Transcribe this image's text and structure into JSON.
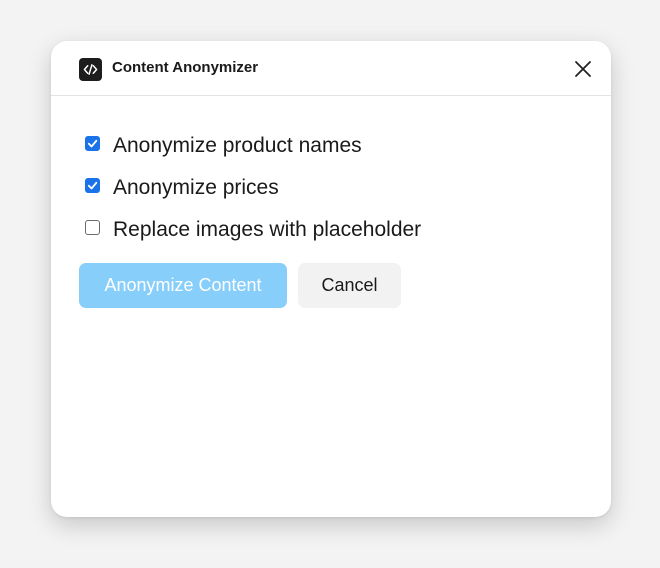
{
  "dialog": {
    "title": "Content Anonymizer",
    "app_icon": "code-icon",
    "close_icon": "close-icon"
  },
  "options": [
    {
      "label": "Anonymize product names",
      "checked": true
    },
    {
      "label": "Anonymize prices",
      "checked": true
    },
    {
      "label": "Replace images with placeholder",
      "checked": false
    }
  ],
  "actions": {
    "primary_label": "Anonymize Content",
    "secondary_label": "Cancel"
  },
  "colors": {
    "primary_button": "#87cefa",
    "checkbox_checked": "#1a73e8",
    "background": "#f3f3f3"
  }
}
